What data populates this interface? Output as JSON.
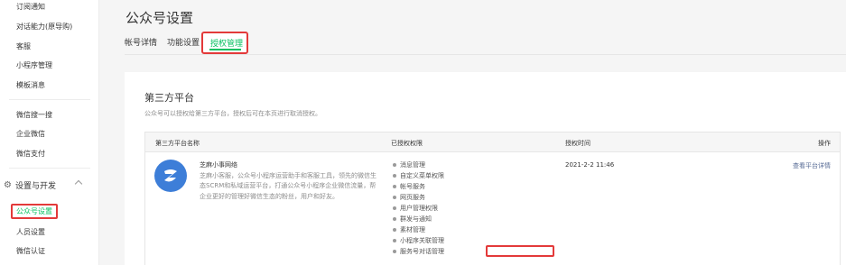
{
  "sidebar": {
    "items_top": [
      "订阅通知",
      "对话能力(原导购)",
      "客服",
      "小程序管理",
      "模板消息"
    ],
    "items_mid": [
      "微信搜一搜",
      "企业微信",
      "微信支付"
    ],
    "section_label": "设置与开发",
    "active_item": "公众号设置",
    "items_bottom": [
      "人员设置",
      "微信认证"
    ]
  },
  "page": {
    "title": "公众号设置",
    "tabs": [
      "帐号详情",
      "功能设置",
      "授权管理"
    ]
  },
  "card": {
    "title": "第三方平台",
    "description": "公众号可以授权给第三方平台，授权后可在本页进行取消授权。",
    "columns": [
      "第三方平台名称",
      "已授权权限",
      "授权时间",
      "操作"
    ],
    "row": {
      "name": "芝麻小事网络",
      "description": "芝麻小客服，公众号小程序运营助手和客服工具，领先的微信生态SCRM和私域运营平台，打通公众号小程序企业微信流量，帮企业更好的管理好微信生态的粉丝，用户和好友。",
      "permissions": [
        "消息管理",
        "自定义菜单权限",
        "帐号服务",
        "网页服务",
        "用户管理权限",
        "群发与通知",
        "素材管理",
        "小程序关联管理",
        "服务号对话管理"
      ],
      "auth_time": "2021-2-2 11:46",
      "action": "查看平台详情"
    }
  },
  "colors": {
    "accent_green": "#07c160",
    "highlight_red": "#e33a3a",
    "link_blue": "#576b95",
    "logo_blue": "#3d7ed8"
  }
}
